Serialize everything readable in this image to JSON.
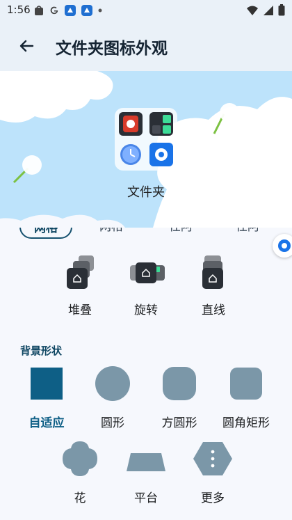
{
  "status_bar": {
    "time": "1:56"
  },
  "header": {
    "title": "文件夹图标外观"
  },
  "preview": {
    "folder_label": "文件夹"
  },
  "layout_tabs": [
    {
      "label": "网格",
      "selected": true
    },
    {
      "label": "网格",
      "selected": false
    },
    {
      "label": "任阿",
      "selected": false
    },
    {
      "label": "任阿",
      "selected": false
    }
  ],
  "icon_styles": [
    {
      "label": "堆叠"
    },
    {
      "label": "旋转"
    },
    {
      "label": "直线"
    }
  ],
  "background_shape": {
    "section_title": "背景形状",
    "options": [
      {
        "label": "自适应",
        "selected": true
      },
      {
        "label": "圆形",
        "selected": false
      },
      {
        "label": "方圆形",
        "selected": false
      },
      {
        "label": "圆角矩形",
        "selected": false
      },
      {
        "label": "花",
        "selected": false
      },
      {
        "label": "平台",
        "selected": false
      },
      {
        "label": "更多",
        "selected": false
      }
    ]
  },
  "colors": {
    "accent": "#0e5f86",
    "shape_fill": "#7b97a8",
    "selected_shape": "#0e5f86",
    "preview_sky": "#bde3fb"
  }
}
